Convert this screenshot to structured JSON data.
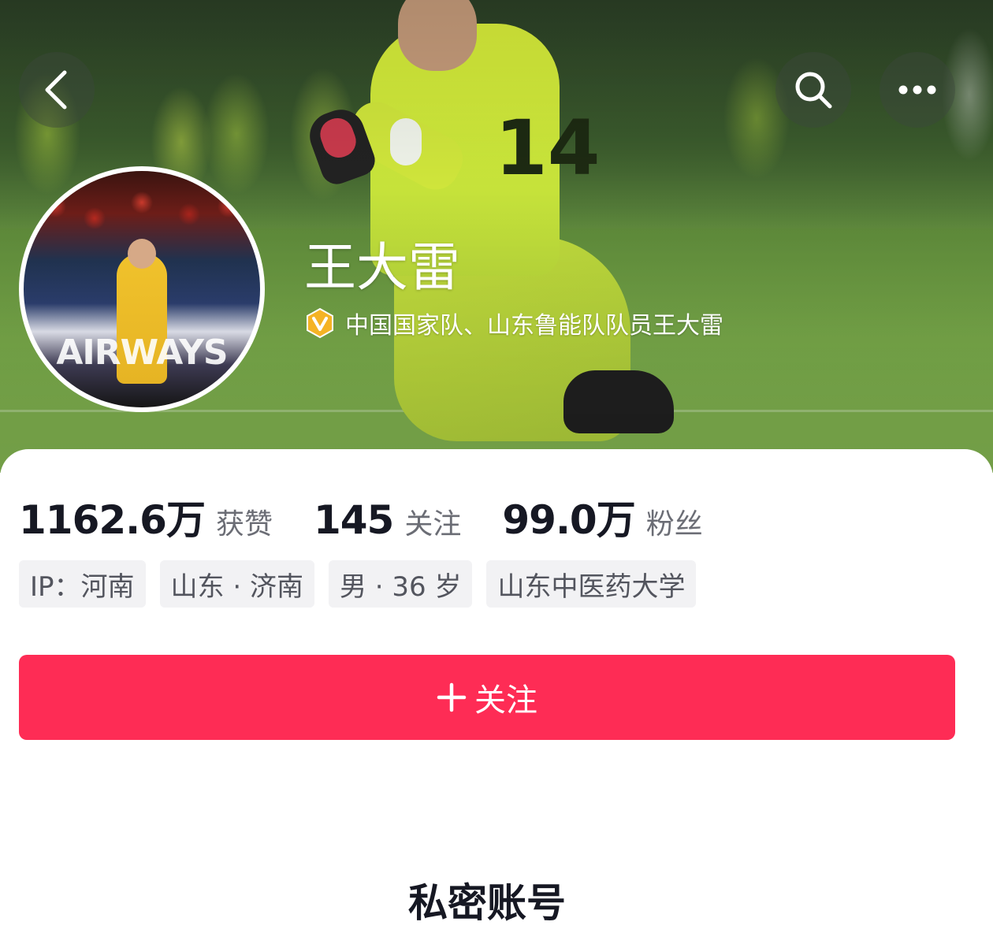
{
  "header": {
    "name": "王大雷",
    "verification": "中国国家队、山东鲁能队队员王大雷",
    "shirt_number": "14",
    "avatar_banner_text": "AIRWAYS"
  },
  "nav": {
    "back_icon": "chevron-left-icon",
    "search_icon": "search-icon",
    "more_icon": "more-dots-icon"
  },
  "stats": [
    {
      "value": "1162.6万",
      "label": "获赞"
    },
    {
      "value": "145",
      "label": "关注"
    },
    {
      "value": "99.0万",
      "label": "粉丝"
    }
  ],
  "tags": [
    "IP：河南",
    "山东 · 济南",
    "男 · 36 岁",
    "山东中医药大学"
  ],
  "follow_button": {
    "icon": "+",
    "label": "关注"
  },
  "private_title": "私密账号",
  "colors": {
    "accent": "#fe2c55",
    "verified_badge": "#f5b325",
    "text_primary": "#161823",
    "text_secondary": "#6b6d75",
    "tag_bg": "#f2f2f4"
  }
}
